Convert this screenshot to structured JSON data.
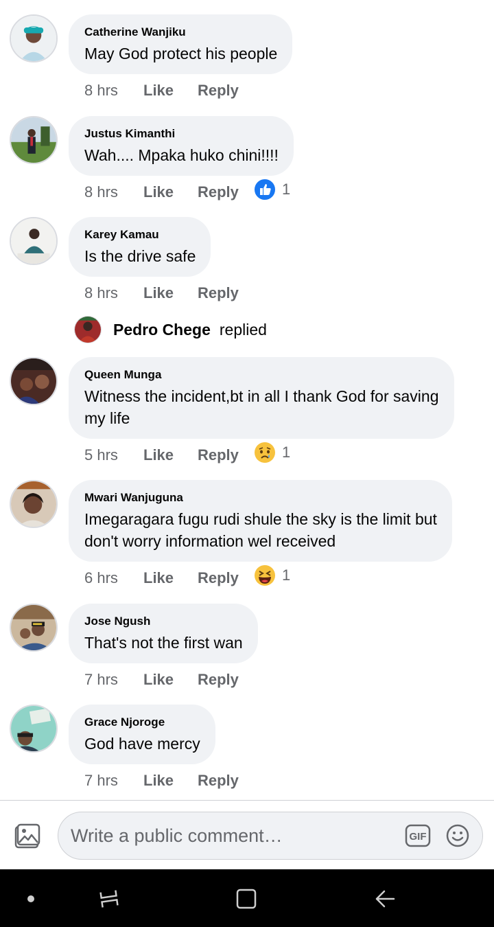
{
  "comments": [
    {
      "author": "Catherine Wanjiku",
      "text": "May God protect his people",
      "time": "8 hrs",
      "like": "Like",
      "reply": "Reply"
    },
    {
      "author": "Justus Kimanthi",
      "text": "Wah.... Mpaka huko chini!!!!",
      "time": "8 hrs",
      "like": "Like",
      "reply": "Reply",
      "reaction": {
        "icon": "like-reaction-icon",
        "count": "1"
      }
    },
    {
      "author": "Karey Kamau",
      "text": "Is the drive safe",
      "time": "8 hrs",
      "like": "Like",
      "reply": "Reply",
      "replies_summary": {
        "name": "Pedro Chege",
        "word": "replied"
      }
    },
    {
      "author": "Queen Munga",
      "text_lines": [
        "Witness the incident,bt in all I thank God for saving",
        "my life"
      ],
      "time": "5 hrs",
      "like": "Like",
      "reply": "Reply",
      "reaction": {
        "icon": "sad-reaction-icon",
        "count": "1"
      }
    },
    {
      "author": "Mwari Wanjuguna",
      "text_lines": [
        "Imegaragara fugu rudi shule the sky is the limit but",
        "don't worry information wel received"
      ],
      "time": "6 hrs",
      "like": "Like",
      "reply": "Reply",
      "reaction": {
        "icon": "haha-reaction-icon",
        "count": "1"
      }
    },
    {
      "author": "Jose Ngush",
      "text": "That's not the first wan",
      "time": "7 hrs",
      "like": "Like",
      "reply": "Reply"
    },
    {
      "author": "Grace Njoroge",
      "text": "God have mercy",
      "time": "7 hrs",
      "like": "Like",
      "reply": "Reply"
    }
  ],
  "composer": {
    "placeholder": "Write a public comment…",
    "gif_label": "GIF"
  },
  "colors": {
    "bubble": "#f0f2f5",
    "secondary_text": "#65676b",
    "like_blue": "#1877f2"
  }
}
